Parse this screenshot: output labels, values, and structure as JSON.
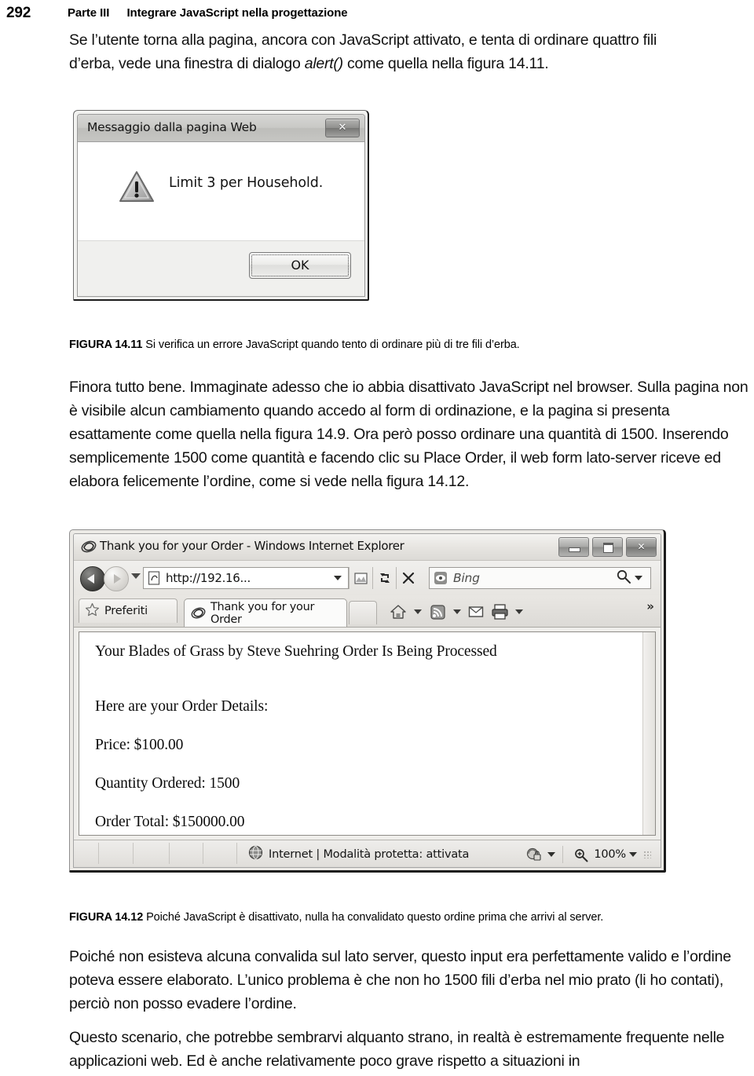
{
  "page": {
    "folio": "292",
    "part": "Parte III",
    "running_title": "Integrare JavaScript nella progettazione"
  },
  "paragraphs": {
    "intro_line1": "Se l’utente torna alla pagina, ancora con JavaScript attivato, e tenta di ordinare quattro fili",
    "intro_line2_a": "d’erba, vede una finestra di dialogo ",
    "intro_italic": "alert()",
    "intro_line2_b": " come quella nella figura 14.11.",
    "middle": "Finora tutto bene. Immaginate adesso che io abbia disattivato JavaScript nel browser. Sulla pagina non è visibile alcun cambiamento quando accedo al form di ordinazione, e la pagina si presenta esattamente come quella nella figura 14.9. Ora però posso ordinare una quantità di 1500. Inserendo semplicemente 1500 come quantità e facendo clic su Place Order, il web form lato-server riceve ed elabora felicemente l’ordine, come si vede nella figura 14.12.",
    "end1": "Poiché non esisteva alcuna convalida sul lato server, questo input era perfettamente valido e l’ordine poteva essere elaborato. L’unico problema è che non ho 1500 fili d’erba nel mio prato (li ho contati), perciò non posso evadere l’ordine.",
    "end2": "Questo scenario, che potrebbe sembrarvi alquanto strano, in realtà è estremamente frequente nelle applicazioni web. Ed è anche relativamente poco grave rispetto a situazioni in"
  },
  "captions": {
    "fig_1411_label": "FIGURA 14.11",
    "fig_1411_text": "Si verifica un errore JavaScript quando tento di ordinare più di tre fili d’erba.",
    "fig_1412_label": "FIGURA 14.12",
    "fig_1412_text": "Poiché JavaScript è disattivato, nulla ha convalidato questo ordine prima che arrivi al server."
  },
  "alert_dialog": {
    "title": "Messaggio dalla pagina Web",
    "close_glyph": "✕",
    "message": "Limit 3 per Household.",
    "ok_label": "OK",
    "icon": "warning-triangle-icon"
  },
  "browser": {
    "window_title": "Thank you for your Order - Windows Internet Explorer",
    "window_controls": {
      "minimize": "minimize",
      "maximize": "maximize",
      "close_glyph": "✕"
    },
    "address_bar": {
      "url": "http://192.16...",
      "buttons": [
        "compatibility-view-icon",
        "refresh-icon",
        "stop-icon"
      ]
    },
    "search": {
      "provider": "Bing",
      "placeholder": "Bing"
    },
    "favorites_button": "Preferiti",
    "tab": {
      "label": "Thank you for your Order"
    },
    "new_tab": "",
    "command_bar_overflow": "»",
    "status": {
      "zone": "Internet | Modalità protetta: attivata",
      "zoom": "100%"
    }
  },
  "web_page": {
    "heading": "Your Blades of Grass by Steve Suehring Order Is Being Processed",
    "details_label": "Here are your Order Details:",
    "price": "Price: $100.00",
    "quantity": "Quantity Ordered: 1500",
    "total": "Order Total: $150000.00"
  },
  "colors": {
    "page_background": "#ffffff",
    "text": "#111111",
    "chrome_gray": "#e7e5e1",
    "titlebar_gray": "#c9c9c6"
  }
}
